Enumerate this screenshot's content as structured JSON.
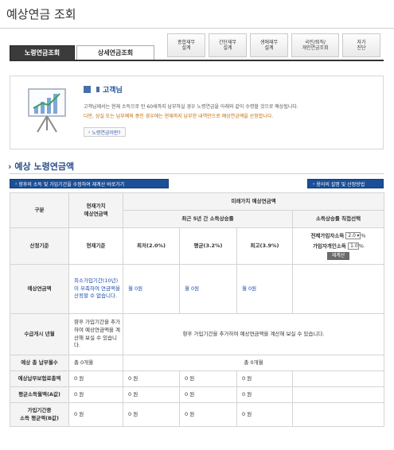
{
  "page": {
    "title": "예상연금 조회"
  },
  "tabs": {
    "main": [
      "노령연금조회",
      "상세연금조회"
    ],
    "sub": [
      {
        "label": "종합재무\n설계"
      },
      {
        "label": "간단재무\n설계"
      },
      {
        "label": "생애재무\n설계"
      },
      {
        "label": "국민/퇴직/\n개인연금조회"
      },
      {
        "label": "자가\n진단"
      }
    ]
  },
  "info": {
    "greeting": "고객님",
    "desc_line1": "고객님께서는 현재 소득으로 만 60세까지 납부하실 경우 노령연금을 아래와 같이 수령할 것으로 예상됩니다.",
    "desc_line2": "다만, 상실 또는 납부예외 중인 경우에는 현재까지 납부한 내역만으로 예상연금액을 산정합니다.",
    "more_label": "노령연금이란?",
    "accent_color": "#c06a00"
  },
  "section": {
    "title": "예상 노령연금액",
    "left_button": "향후의 소득 및 가입기간을 수정하여 재계산 바로가기",
    "right_button": "용어의 설명 및 산정방법"
  },
  "table": {
    "col_group": "구분",
    "col_current": "현재가치\n예상연금액",
    "col_future": "미래가치 예상연금액",
    "col_recent5": "최근 5년 간 소득상승률",
    "col_direct": "소득상승률 직접선택",
    "basis_label": "산정기준",
    "basis_current": "현재기준",
    "basis_min": "최저(2.0%)",
    "basis_avg": "평균(3.2%)",
    "basis_max": "최고(3.9%)",
    "direct_rate_label": "전체가입자소득",
    "direct_rate_value": "2.0",
    "direct_period_label": "가입자개인소득",
    "direct_period_value": "1.0",
    "percent": "%",
    "recalc": "재계산",
    "pension_label": "예상연금액",
    "pension_current_msg": "최소가입기간(10년)이 부족하여 연금액을 산정할 수 없습니다.",
    "pension_min": "월 0원",
    "pension_avg": "월 0원",
    "pension_max": "월 0원",
    "start_label": "수급개시 년월",
    "start_current": "향후 가입기간을 추가하여 예상연금액을 계산해 보실 수 있습니다.",
    "start_future": "향후 가입기간을 추가하여 예상연금액을 계산해 보실 수 있습니다.",
    "months_label": "예상 총 납부월수",
    "months_current": "총 0개월",
    "months_future": "총 0개월",
    "rows": [
      {
        "label": "예상납부보험료총액",
        "values": [
          "0 원",
          "0 원",
          "0 원",
          "0 원"
        ]
      },
      {
        "label": "평균소득월액(A값)",
        "values": [
          "0 원",
          "0 원",
          "0 원",
          "0 원"
        ]
      },
      {
        "label": "가입기간중\n소득 평균액(B값)",
        "values": [
          "0 원",
          "0 원",
          "0 원",
          "0 원"
        ]
      }
    ]
  }
}
